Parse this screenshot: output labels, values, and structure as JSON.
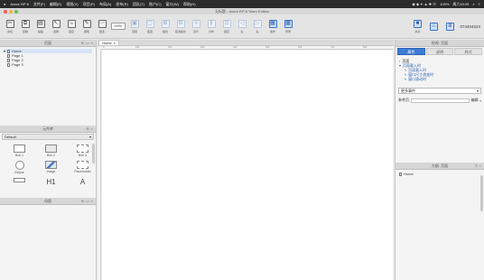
{
  "menubar": {
    "items": [
      "Axure RP 8",
      "文件(F)",
      "编辑(E)",
      "视图(V)",
      "项目(P)",
      "布局(A)",
      "发布(R)",
      "团队(T)",
      "账户(C)",
      "窗口(W)",
      "帮助(H)"
    ],
    "status": [
      "100%",
      "周六10:29"
    ]
  },
  "titlebar": {
    "title": "无标题 - Axure RP 8 Team Edition"
  },
  "toolbar": {
    "zoom": "100%",
    "account": "074404224",
    "buttons": [
      "剪切",
      "复制",
      "粘贴",
      "选择",
      "连接",
      "钢笔",
      "更多",
      "顶层",
      "底层",
      "组合",
      "取消组合",
      "对齐",
      "分布",
      "锁定",
      "左",
      "右",
      "发布",
      "登录",
      "共享"
    ]
  },
  "pages": {
    "header": "页面",
    "items": [
      "Home",
      "Page 1",
      "Page 2",
      "Page 3"
    ]
  },
  "library": {
    "header": "元件库",
    "selected": "Default",
    "widgets": [
      "Box 1",
      "Box 2",
      "Box 3",
      "Ellipse",
      "Image",
      "Placeholder",
      "Button",
      "Heading 1",
      "Text",
      "Label",
      "Link",
      "Hot Spot"
    ],
    "master_header": "母版"
  },
  "canvas": {
    "tab": "Home",
    "ruler_marks": [
      "0",
      "100",
      "200",
      "300",
      "400",
      "500",
      "600",
      "700",
      "800"
    ]
  },
  "inspector": {
    "header": "检视: 页面",
    "tabs": [
      "属性",
      "说明",
      "样式"
    ],
    "events": [
      "页面",
      "页面载入时",
      "页面载入时",
      "窗口尺寸改变时",
      "窗口滚动时"
    ],
    "condition": "更多事件",
    "ref_label": "参考页",
    "ref_value": "编辑"
  },
  "outline": {
    "header": "大纲: 页面",
    "item": "Home"
  },
  "colors": {
    "accent": "#3e7bd6",
    "menubar": "#2b2b2b"
  }
}
